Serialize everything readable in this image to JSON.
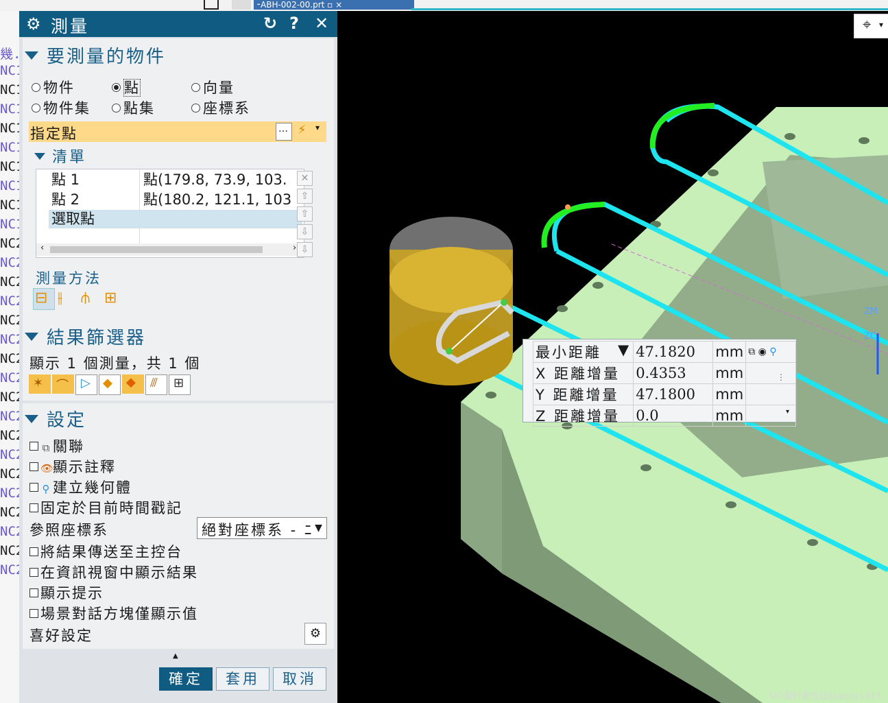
{
  "window_tab": "⁃ABH-002-00.prt ▫ ×",
  "left_nav": {
    "rows": [
      "幾.",
      "NC1",
      "NC1",
      "NC1",
      "NC1",
      "NC1",
      "NC1",
      "NC1",
      "NC1",
      "NC1",
      "NC2",
      "NC2",
      "NC2",
      "NC2",
      "NC2",
      "NC2",
      "NC2",
      "NC2",
      "NC2",
      "NC2",
      "NC2",
      "NC2",
      "NC2",
      "NC2",
      "NC2",
      "NC2",
      "NC2",
      "NC2"
    ]
  },
  "dialog": {
    "title": "測量",
    "reset_icon": "↻",
    "help_icon": "?",
    "close_icon": "✕",
    "objects_section": {
      "header": "要測量的物件",
      "options": [
        {
          "label": "物件",
          "selected": false
        },
        {
          "label": "點",
          "selected": true
        },
        {
          "label": "向量",
          "selected": false
        },
        {
          "label": "物件集",
          "selected": false
        },
        {
          "label": "點集",
          "selected": false
        },
        {
          "label": "座標系",
          "selected": false
        }
      ],
      "specify_point": "指定點",
      "point_dialog_icon": "…",
      "list_header": "清單",
      "list_rows": [
        {
          "name": "點 1",
          "value": "點(179.8, 73.9, 103."
        },
        {
          "name": "點 2",
          "value": "點(180.2, 121.1, 103"
        },
        {
          "name": "選取點",
          "value": ""
        }
      ],
      "method_header": "測量方法"
    },
    "filter_section": {
      "header": "結果篩選器",
      "summary": "顯示 1 個測量，共 1 個"
    },
    "settings_section": {
      "header": "設定",
      "checkboxes": [
        {
          "label": "關聯",
          "icon": "associate-icon",
          "glyph": "⧉"
        },
        {
          "label": "顯示註釋",
          "icon": "annotation-icon",
          "glyph": "👁"
        },
        {
          "label": "建立幾何體",
          "icon": "geometry-icon",
          "glyph": "⚲"
        },
        {
          "label": "固定於目前時間戳記",
          "icon": "",
          "glyph": ""
        }
      ],
      "reference_csys_label": "參照座標系",
      "reference_csys_value": "絕對座標系 - ﾆ",
      "checkboxes2": [
        "將結果傳送至主控台",
        "在資訊視窗中顯示結果",
        "顯示提示",
        "場景對話方塊僅顯示值"
      ],
      "preferences_label": "喜好設定"
    },
    "buttons": {
      "ok": "確定",
      "apply": "套用",
      "cancel": "取消"
    }
  },
  "measurement": {
    "rows": [
      {
        "label": "最小距離",
        "value": "47.1820",
        "unit": "mm"
      },
      {
        "label": "X 距離增量",
        "value": "0.4353",
        "unit": "mm"
      },
      {
        "label": "Y 距離增量",
        "value": "47.1800",
        "unit": "mm"
      },
      {
        "label": "Z 距離增量",
        "value": "0.0",
        "unit": "mm"
      }
    ]
  },
  "viewport": {
    "axis_labels": [
      "ZM",
      "ZC"
    ],
    "watermark": "UG爱好者论坛@andy1414"
  }
}
